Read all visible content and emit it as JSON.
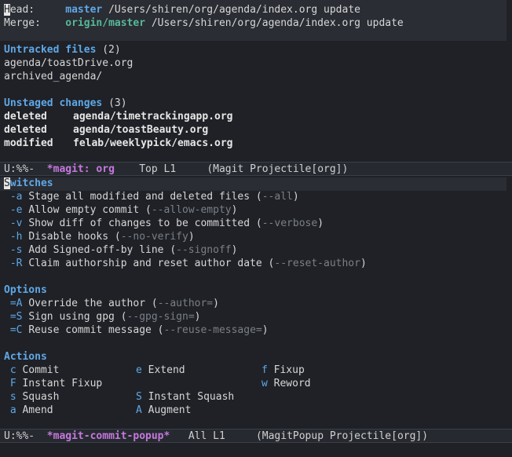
{
  "head": {
    "label": "Head:",
    "branch": "master",
    "path": "/Users/shiren/org/agenda/index.org update"
  },
  "merge": {
    "label": "Merge:",
    "branch": "origin/master",
    "path": "/Users/shiren/org/agenda/index.org update"
  },
  "untracked": {
    "title": "Untracked files",
    "count": "(2)",
    "files": [
      "agenda/toastDrive.org",
      "archived_agenda/"
    ]
  },
  "unstaged": {
    "title": "Unstaged changes",
    "count": "(3)",
    "items": [
      {
        "status": "deleted",
        "file": "agenda/timetrackingapp.org"
      },
      {
        "status": "deleted",
        "file": "agenda/toastBeauty.org"
      },
      {
        "status": "modified",
        "file": "felab/weeklypick/emacs.org"
      }
    ]
  },
  "modeline1": {
    "state": "U:%%-",
    "buffer": "*magit: org",
    "pos": "Top L1",
    "mode": "(Magit Projectile[org])"
  },
  "switches": {
    "title": "Switches",
    "items": [
      {
        "key": "-a",
        "desc": "Stage all modified and deleted files",
        "flag": "--all"
      },
      {
        "key": "-e",
        "desc": "Allow empty commit",
        "flag": "--allow-empty"
      },
      {
        "key": "-v",
        "desc": "Show diff of changes to be committed",
        "flag": "--verbose"
      },
      {
        "key": "-h",
        "desc": "Disable hooks",
        "flag": "--no-verify"
      },
      {
        "key": "-s",
        "desc": "Add Signed-off-by line",
        "flag": "--signoff"
      },
      {
        "key": "-R",
        "desc": "Claim authorship and reset author date",
        "flag": "--reset-author"
      }
    ]
  },
  "options": {
    "title": "Options",
    "items": [
      {
        "key": "=A",
        "desc": "Override the author",
        "flag": "--author="
      },
      {
        "key": "=S",
        "desc": "Sign using gpg",
        "flag": "--gpg-sign="
      },
      {
        "key": "=C",
        "desc": "Reuse commit message",
        "flag": "--reuse-message="
      }
    ]
  },
  "actions": {
    "title": "Actions",
    "rows": [
      [
        {
          "key": "c",
          "label": "Commit"
        },
        {
          "key": "e",
          "label": "Extend"
        },
        {
          "key": "f",
          "label": "Fixup"
        }
      ],
      [
        {
          "key": "F",
          "label": "Instant Fixup"
        },
        {
          "key": "",
          "label": ""
        },
        {
          "key": "w",
          "label": "Reword"
        }
      ],
      [
        {
          "key": "s",
          "label": "Squash"
        },
        {
          "key": "S",
          "label": "Instant Squash"
        },
        {
          "key": "",
          "label": ""
        }
      ],
      [
        {
          "key": "a",
          "label": "Amend"
        },
        {
          "key": "A",
          "label": "Augment"
        },
        {
          "key": "",
          "label": ""
        }
      ]
    ]
  },
  "modeline2": {
    "state": "U:%%-",
    "buffer": "*magit-commit-popup*",
    "pos": "All L1",
    "mode": "(MagitPopup Projectile[org])"
  }
}
